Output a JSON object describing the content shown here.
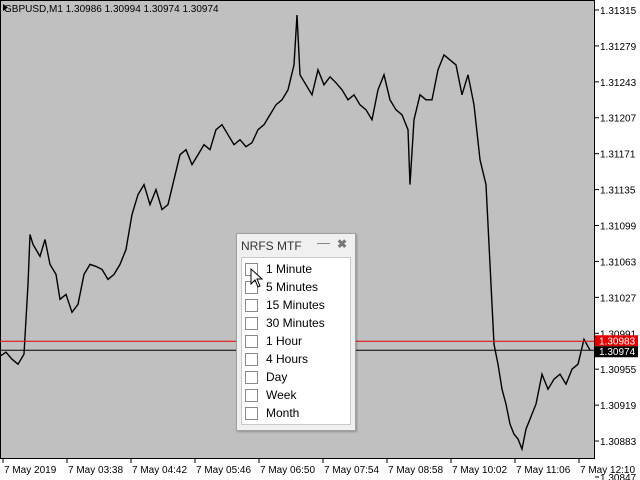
{
  "chart_header": "GBPUSD,M1  1.30986 1.30994 1.30974 1.30974",
  "colors": {
    "background": "#c0c0c0",
    "line": "#000000",
    "bid": "#e00000",
    "ask": "#000000"
  },
  "chart_data": {
    "type": "line",
    "title": "GBPUSD,M1  1.30986 1.30994 1.30974 1.30974",
    "xlabel": "",
    "ylabel": "",
    "ylim": [
      1.30865,
      1.31325
    ],
    "y_ticks": [
      "1.31315",
      "1.31279",
      "1.31243",
      "1.31207",
      "1.31171",
      "1.31135",
      "1.31099",
      "1.31063",
      "1.31027",
      "1.30991",
      "1.30955",
      "1.30919",
      "1.30883",
      "1.30847"
    ],
    "x_labels": [
      "7 May 2019",
      "7 May 03:38",
      "7 May 04:42",
      "7 May 05:46",
      "7 May 06:50",
      "7 May 07:54",
      "7 May 08:58",
      "7 May 10:02",
      "7 May 11:06",
      "7 May 12:10"
    ],
    "price_labels": {
      "bid": "1.30983",
      "ask": "1.30974"
    },
    "x": [
      0,
      6,
      12,
      18,
      24,
      28,
      30,
      33,
      36,
      40,
      45,
      50,
      56,
      60,
      66,
      72,
      78,
      84,
      90,
      96,
      102,
      108,
      114,
      120,
      126,
      132,
      138,
      144,
      150,
      156,
      162,
      168,
      174,
      180,
      186,
      192,
      198,
      204,
      210,
      216,
      222,
      228,
      234,
      240,
      246,
      252,
      258,
      264,
      270,
      276,
      282,
      288,
      294,
      297,
      300,
      306,
      312,
      318,
      324,
      330,
      336,
      342,
      348,
      354,
      360,
      366,
      372,
      378,
      384,
      390,
      396,
      402,
      408,
      410,
      414,
      420,
      426,
      432,
      438,
      444,
      450,
      456,
      462,
      468,
      474,
      480,
      486,
      490,
      494,
      498,
      502,
      506,
      510,
      514,
      518,
      522,
      526,
      530,
      536,
      542,
      548,
      554,
      560,
      566,
      572,
      578,
      584,
      590
    ],
    "values": [
      1.30968,
      1.30972,
      1.30965,
      1.3096,
      1.3097,
      1.3104,
      1.3109,
      1.3108,
      1.31075,
      1.31068,
      1.31085,
      1.3106,
      1.3105,
      1.31025,
      1.3103,
      1.31012,
      1.3102,
      1.3105,
      1.3106,
      1.31058,
      1.31055,
      1.31045,
      1.3105,
      1.3106,
      1.31075,
      1.3111,
      1.3113,
      1.3114,
      1.3112,
      1.31135,
      1.31115,
      1.3112,
      1.31145,
      1.3117,
      1.31175,
      1.3116,
      1.3117,
      1.3118,
      1.31175,
      1.31195,
      1.312,
      1.3119,
      1.3118,
      1.31185,
      1.31178,
      1.31182,
      1.31195,
      1.312,
      1.3121,
      1.3122,
      1.31225,
      1.31235,
      1.3126,
      1.3131,
      1.3125,
      1.3124,
      1.3123,
      1.31255,
      1.3124,
      1.31248,
      1.31242,
      1.31235,
      1.31225,
      1.3123,
      1.3122,
      1.31215,
      1.31205,
      1.31235,
      1.3125,
      1.31225,
      1.31215,
      1.3121,
      1.31195,
      1.3114,
      1.31205,
      1.3123,
      1.31225,
      1.31225,
      1.31255,
      1.3127,
      1.31265,
      1.3126,
      1.3123,
      1.3125,
      1.3122,
      1.31165,
      1.3114,
      1.3106,
      1.3098,
      1.3096,
      1.30935,
      1.3092,
      1.309,
      1.3089,
      1.30885,
      1.30875,
      1.30895,
      1.30905,
      1.3092,
      1.3095,
      1.30935,
      1.30945,
      1.3095,
      1.3094,
      1.30955,
      1.3096,
      1.30985,
      1.30974
    ]
  },
  "panel": {
    "title": "NRFS MTF",
    "minimize_symbol": "—",
    "close_symbol": "✖",
    "timeframes": [
      "1 Minute",
      "5 Minutes",
      "15 Minutes",
      "30 Minutes",
      "1 Hour",
      "4 Hours",
      "Day",
      "Week",
      "Month"
    ]
  }
}
